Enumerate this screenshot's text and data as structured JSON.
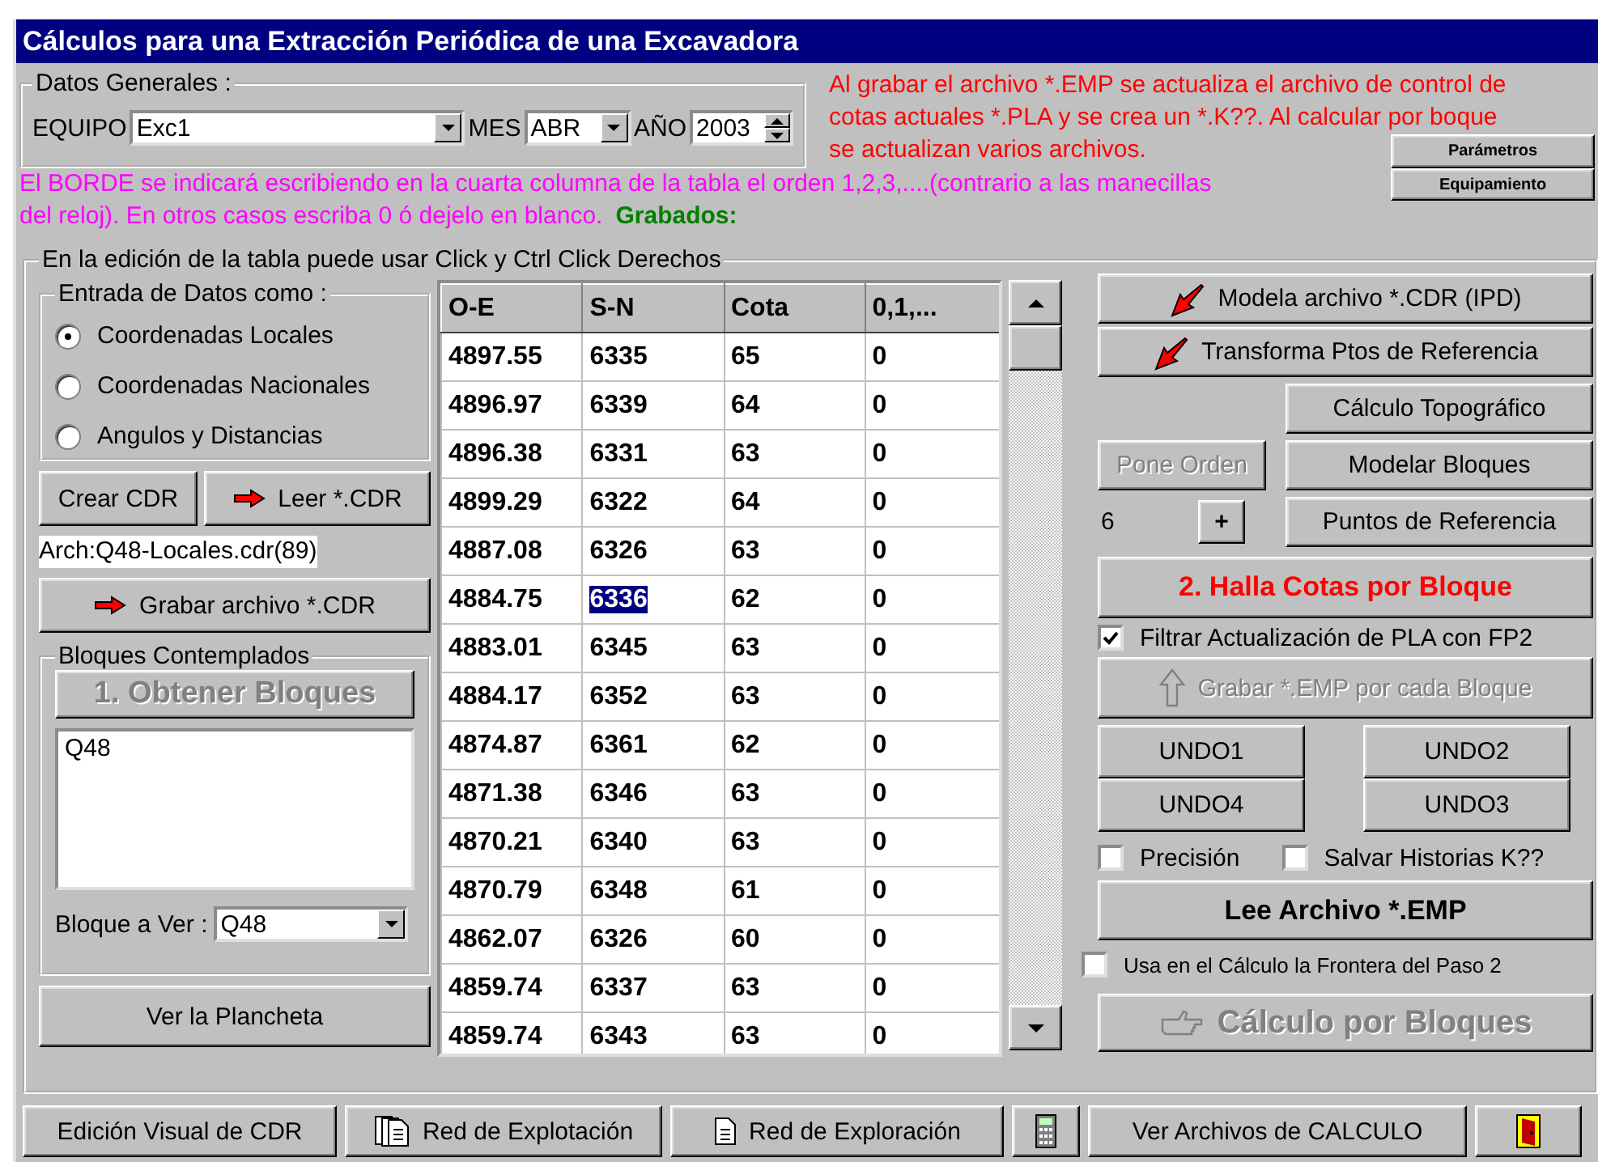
{
  "window": {
    "title": "Cálculos para una Extracción Periódica de una Excavadora"
  },
  "general": {
    "legend": "Datos Generales :",
    "equipo": {
      "label": "EQUIPO",
      "value": "Exc1"
    },
    "mes": {
      "label": "MES",
      "value": "ABR"
    },
    "anio": {
      "label": "AÑO",
      "value": "2003"
    }
  },
  "info_lines": [
    "Al grabar el archivo *.EMP se actualiza el archivo de control de",
    "cotas actuales *.PLA y se crea un *.K??. Al  calcular por boque",
    "se actualizan varios archivos."
  ],
  "header_buttons": [
    "Parámetros",
    "Equipamiento"
  ],
  "border_note": [
    "El BORDE se indicará escribiendo en la cuarta columna de la tabla el orden 1,2,3,....(contrario a las manecillas",
    "del reloj). En otros casos escriba 0 ó dejelo en blanco."
  ],
  "saved_label": "Grabados:",
  "edit_group": {
    "legend": "En la edición de la tabla puede usar Click y Ctrl Click Derechos"
  },
  "entry": {
    "legend": "Entrada de Datos como :",
    "options": [
      {
        "label": "Coordenadas Locales",
        "selected": true
      },
      {
        "label": "Coordenadas Nacionales",
        "selected": false
      },
      {
        "label": "Angulos y Distancias",
        "selected": false
      }
    ]
  },
  "create_button": "Crear CDR",
  "read_button": "Leer *.CDR",
  "file_label": "Arch:Q48-Locales.cdr(89)",
  "save_button": "Grabar archivo  *.CDR",
  "blocks": {
    "legend": "Bloques Contemplados",
    "obtain_button": {
      "label": "1. Obtener Bloques",
      "disabled": true
    },
    "items": [
      "Q48"
    ],
    "view": {
      "label": "Bloque a Ver :",
      "value": "Q48"
    }
  },
  "plancheta_button": "Ver la Plancheta",
  "table": {
    "columns": [
      "O-E",
      "S-N",
      "Cota",
      "0,1,..."
    ],
    "rows": [
      {
        "cells": [
          {
            "text": "4897.55",
            "selected": false
          },
          {
            "text": "6335",
            "selected": false
          },
          {
            "text": "65",
            "selected": false
          },
          {
            "text": "0",
            "selected": false
          }
        ]
      },
      {
        "cells": [
          {
            "text": "4896.97",
            "selected": false
          },
          {
            "text": "6339",
            "selected": false
          },
          {
            "text": "64",
            "selected": false
          },
          {
            "text": "0",
            "selected": false
          }
        ]
      },
      {
        "cells": [
          {
            "text": "4896.38",
            "selected": false
          },
          {
            "text": "6331",
            "selected": false
          },
          {
            "text": "63",
            "selected": false
          },
          {
            "text": "0",
            "selected": false
          }
        ]
      },
      {
        "cells": [
          {
            "text": "4899.29",
            "selected": false
          },
          {
            "text": "6322",
            "selected": false
          },
          {
            "text": "64",
            "selected": false
          },
          {
            "text": "0",
            "selected": false
          }
        ]
      },
      {
        "cells": [
          {
            "text": "4887.08",
            "selected": false
          },
          {
            "text": "6326",
            "selected": false
          },
          {
            "text": "63",
            "selected": false
          },
          {
            "text": "0",
            "selected": false
          }
        ]
      },
      {
        "cells": [
          {
            "text": "4884.75",
            "selected": false
          },
          {
            "text": "6336",
            "selected": true
          },
          {
            "text": "62",
            "selected": false
          },
          {
            "text": "0",
            "selected": false
          }
        ]
      },
      {
        "cells": [
          {
            "text": "4883.01",
            "selected": false
          },
          {
            "text": "6345",
            "selected": false
          },
          {
            "text": "63",
            "selected": false
          },
          {
            "text": "0",
            "selected": false
          }
        ]
      },
      {
        "cells": [
          {
            "text": "4884.17",
            "selected": false
          },
          {
            "text": "6352",
            "selected": false
          },
          {
            "text": "63",
            "selected": false
          },
          {
            "text": "0",
            "selected": false
          }
        ]
      },
      {
        "cells": [
          {
            "text": "4874.87",
            "selected": false
          },
          {
            "text": "6361",
            "selected": false
          },
          {
            "text": "62",
            "selected": false
          },
          {
            "text": "0",
            "selected": false
          }
        ]
      },
      {
        "cells": [
          {
            "text": "4871.38",
            "selected": false
          },
          {
            "text": "6346",
            "selected": false
          },
          {
            "text": "63",
            "selected": false
          },
          {
            "text": "0",
            "selected": false
          }
        ]
      },
      {
        "cells": [
          {
            "text": "4870.21",
            "selected": false
          },
          {
            "text": "6340",
            "selected": false
          },
          {
            "text": "63",
            "selected": false
          },
          {
            "text": "0",
            "selected": false
          }
        ]
      },
      {
        "cells": [
          {
            "text": "4870.79",
            "selected": false
          },
          {
            "text": "6348",
            "selected": false
          },
          {
            "text": "61",
            "selected": false
          },
          {
            "text": "0",
            "selected": false
          }
        ]
      },
      {
        "cells": [
          {
            "text": "4862.07",
            "selected": false
          },
          {
            "text": "6326",
            "selected": false
          },
          {
            "text": "60",
            "selected": false
          },
          {
            "text": "0",
            "selected": false
          }
        ]
      },
      {
        "cells": [
          {
            "text": "4859.74",
            "selected": false
          },
          {
            "text": "6337",
            "selected": false
          },
          {
            "text": "63",
            "selected": false
          },
          {
            "text": "0",
            "selected": false
          }
        ]
      },
      {
        "cells": [
          {
            "text": "4859.74",
            "selected": false
          },
          {
            "text": "6343",
            "selected": false
          },
          {
            "text": "63",
            "selected": false
          },
          {
            "text": "0",
            "selected": false
          }
        ]
      }
    ]
  },
  "right_panel": {
    "model_button": "Modela archivo  *.CDR (IPD)",
    "transform_button": "Transforma Ptos de Referencia",
    "topo_button": "Cálculo Topográfico",
    "order_button": {
      "label": "Pone Orden",
      "disabled": true
    },
    "model_blocks_button": "Modelar Bloques",
    "counter": {
      "value": "6",
      "button": "+"
    },
    "ref_points_button": "Puntos de Referencia",
    "heights_button": "2. Halla Cotas por Bloque",
    "filter_check": {
      "label": "Filtrar Actualización de PLA con FP2",
      "checked": true
    },
    "save_emp_button": {
      "label": "Grabar *.EMP por cada Bloque",
      "disabled": true
    },
    "undo_buttons": [
      "UNDO1",
      "UNDO2",
      "UNDO4",
      "UNDO3"
    ],
    "precision_check": {
      "label": "Precisión",
      "checked": false
    },
    "history_check": {
      "label": "Salvar Historias K??",
      "checked": false
    },
    "read_emp_button": "Lee  Archivo *.EMP",
    "border_check": {
      "label": "Usa en el Cálculo la Frontera del Paso 2",
      "checked": false
    },
    "calc_blocks_button": {
      "label": "Cálculo por Bloques",
      "disabled": true
    }
  },
  "toolbar": [
    {
      "kind": "text",
      "label": "Edición Visual de CDR"
    },
    {
      "kind": "documents",
      "label": "Red de Explotación"
    },
    {
      "kind": "document",
      "label": "Red  de Exploración"
    },
    {
      "kind": "calculator"
    },
    {
      "kind": "text",
      "label": "Ver Archivos de CALCULO"
    },
    {
      "kind": "exit"
    }
  ]
}
